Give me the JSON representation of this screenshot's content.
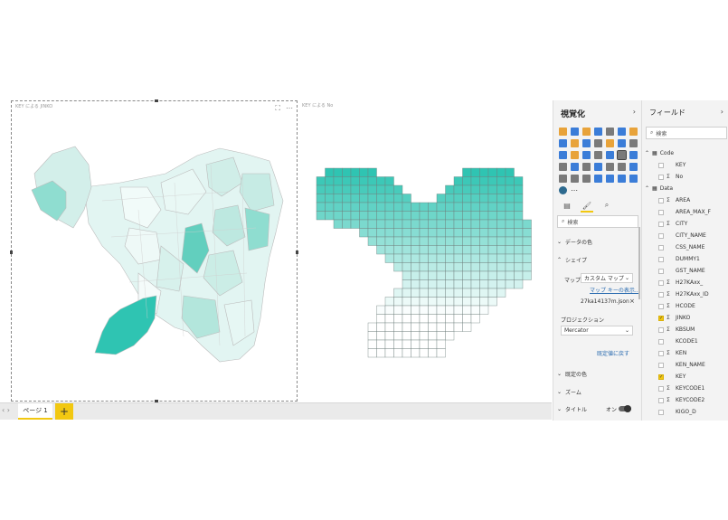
{
  "canvas": {
    "visual1": {
      "title": "KEY による JINKO"
    },
    "visual2": {
      "title": "KEY による No"
    },
    "toolbar_icons": [
      "focus-icon",
      "more-options-icon"
    ],
    "more_label": "⋯"
  },
  "pages": {
    "nav": "‹ ›",
    "tab": "ページ 1",
    "add": "+"
  },
  "viz_pane": {
    "title": "視覚化",
    "chevron": "›",
    "search_placeholder": "検索",
    "sections": {
      "data_colors": "データの色",
      "shape": "シェイプ",
      "default_colors": "既定の色",
      "zoom": "ズーム",
      "title": "タイトル"
    },
    "map_label": "マップ",
    "map_value": "カスタム マップ",
    "map_keys_link": "マップ キーの表示...",
    "file_name": "27ka14137m.json",
    "projection_label": "プロジェクション",
    "projection_value": "Mercator",
    "revert_link": "既定値に戻す",
    "title_toggle": "オン",
    "accent": "#f2c811"
  },
  "fields_pane": {
    "title": "フィールド",
    "chevron": "›",
    "search_placeholder": "検索",
    "tables": [
      {
        "name": "Code",
        "fields": [
          {
            "name": "KEY",
            "sigma": false,
            "checked": false
          },
          {
            "name": "No",
            "sigma": true,
            "checked": false
          }
        ]
      },
      {
        "name": "Data",
        "fields": [
          {
            "name": "AREA",
            "sigma": true,
            "checked": false
          },
          {
            "name": "AREA_MAX_F",
            "sigma": false,
            "checked": false
          },
          {
            "name": "CITY",
            "sigma": true,
            "checked": false
          },
          {
            "name": "CITY_NAME",
            "sigma": false,
            "checked": false
          },
          {
            "name": "CSS_NAME",
            "sigma": false,
            "checked": false
          },
          {
            "name": "DUMMY1",
            "sigma": false,
            "checked": false
          },
          {
            "name": "GST_NAME",
            "sigma": false,
            "checked": false
          },
          {
            "name": "H27KAxx_",
            "sigma": true,
            "checked": false
          },
          {
            "name": "H27KAxx_ID",
            "sigma": true,
            "checked": false
          },
          {
            "name": "HCODE",
            "sigma": true,
            "checked": false
          },
          {
            "name": "JINKO",
            "sigma": true,
            "checked": true
          },
          {
            "name": "KBSUM",
            "sigma": true,
            "checked": false
          },
          {
            "name": "KCODE1",
            "sigma": false,
            "checked": false
          },
          {
            "name": "KEN",
            "sigma": true,
            "checked": false
          },
          {
            "name": "KEN_NAME",
            "sigma": false,
            "checked": false
          },
          {
            "name": "KEY",
            "sigma": false,
            "checked": true
          },
          {
            "name": "KEYCODE1",
            "sigma": true,
            "checked": false
          },
          {
            "name": "KEYCODE2",
            "sigma": true,
            "checked": false
          },
          {
            "name": "KIGO_D",
            "sigma": false,
            "checked": false
          }
        ]
      }
    ]
  }
}
